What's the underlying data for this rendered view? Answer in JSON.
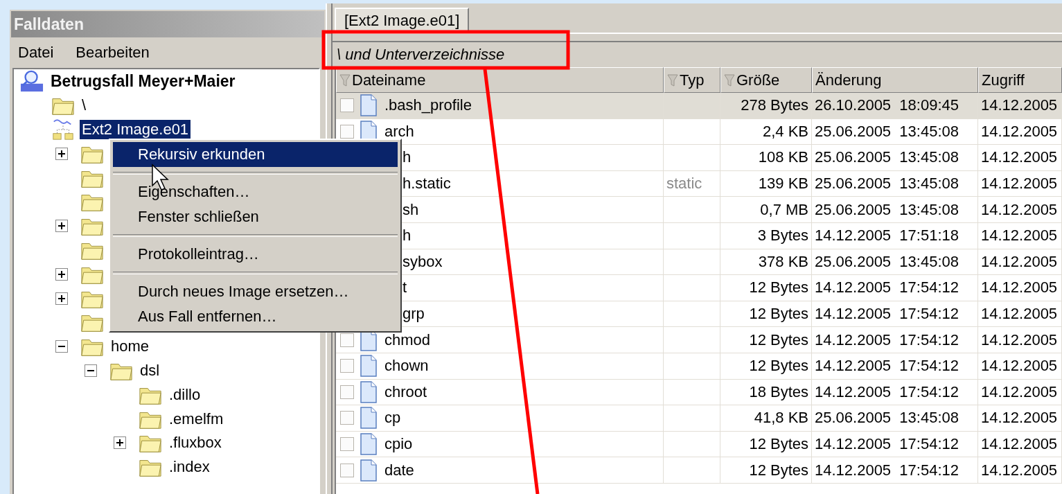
{
  "case_panel": {
    "title": "Falldaten",
    "menu": [
      "Datei",
      "Bearbeiten"
    ],
    "tree": [
      {
        "label": "Betrugsfall Meyer+Maier",
        "kind": "case",
        "selected": false,
        "children": [
          {
            "label": "\\",
            "kind": "leaf",
            "selected": false
          },
          {
            "label": "Ext2 Image.e01",
            "kind": "image",
            "selected": true,
            "children": [
              {
                "kind": "collapsed"
              },
              {
                "kind": "leaf"
              },
              {
                "kind": "leaf"
              },
              {
                "kind": "collapsed"
              },
              {
                "kind": "leaf"
              },
              {
                "kind": "collapsed"
              },
              {
                "kind": "collapsed"
              },
              {
                "kind": "leaf"
              },
              {
                "label": "home",
                "kind": "expanded",
                "selected": false,
                "children": [
                  {
                    "label": "dsl",
                    "kind": "expanded",
                    "selected": false,
                    "children": [
                      {
                        "label": ".dillo",
                        "kind": "leaf",
                        "selected": false
                      },
                      {
                        "label": ".emelfm",
                        "kind": "leaf",
                        "selected": false
                      },
                      {
                        "label": ".fluxbox",
                        "kind": "collapsed",
                        "selected": false
                      },
                      {
                        "label": ".index",
                        "kind": "leaf",
                        "selected": false
                      }
                    ]
                  }
                ]
              }
            ]
          }
        ]
      }
    ]
  },
  "context_menu": [
    {
      "kind": "item",
      "label": "Rekursiv erkunden",
      "selected": true
    },
    {
      "kind": "separator"
    },
    {
      "kind": "item",
      "label": "Eigenschaften…",
      "selected": false
    },
    {
      "kind": "item",
      "label": "Fenster schließen",
      "selected": false
    },
    {
      "kind": "separator"
    },
    {
      "kind": "item",
      "label": "Protokolleintrag…",
      "selected": false
    },
    {
      "kind": "separator"
    },
    {
      "kind": "item",
      "label": "Durch neues Image ersetzen…",
      "selected": false
    },
    {
      "kind": "item",
      "label": "Aus Fall entfernen…",
      "selected": false
    }
  ],
  "tabs": [
    {
      "label": "[Ext2 Image.e01]",
      "selected": true
    }
  ],
  "path": "\\ und Unterverzeichnisse",
  "table": {
    "columns": [
      {
        "label": "Dateiname",
        "filter": true
      },
      {
        "label": "Typ",
        "filter": true
      },
      {
        "label": "Größe",
        "filter": true
      },
      {
        "label": "Änderung",
        "filter": false
      },
      {
        "label": "Zugriff",
        "filter": false
      }
    ],
    "rows": [
      {
        "name": ".bash_profile",
        "size": "278 Bytes",
        "changed": "26.10.2005  18:09:45",
        "accessed": "14.12.2005",
        "selected": true,
        "covered": false
      },
      {
        "name": "arch",
        "size": "2,4 KB",
        "changed": "25.06.2005  13:45:08",
        "accessed": "14.12.2005",
        "selected": false,
        "covered": false
      },
      {
        "name": "h",
        "size": "108 KB",
        "changed": "25.06.2005  13:45:08",
        "accessed": "14.12.2005",
        "selected": false,
        "covered": true
      },
      {
        "name": "h.static",
        "type": "static",
        "size": "139 KB",
        "changed": "25.06.2005  13:45:08",
        "accessed": "14.12.2005",
        "selected": false,
        "covered": true
      },
      {
        "name": "sh",
        "size": "0,7 MB",
        "changed": "25.06.2005  13:45:08",
        "accessed": "14.12.2005",
        "selected": false,
        "covered": true
      },
      {
        "name": "h",
        "size": "3 Bytes",
        "changed": "14.12.2005  17:51:18",
        "accessed": "14.12.2005",
        "selected": false,
        "covered": true
      },
      {
        "name": "sybox",
        "size": "378 KB",
        "changed": "25.06.2005  13:45:08",
        "accessed": "14.12.2005",
        "selected": false,
        "covered": true
      },
      {
        "name": "t",
        "size": "12 Bytes",
        "changed": "14.12.2005  17:54:12",
        "accessed": "14.12.2005",
        "selected": false,
        "covered": true
      },
      {
        "name": "grp",
        "size": "12 Bytes",
        "changed": "14.12.2005  17:54:12",
        "accessed": "14.12.2005",
        "selected": false,
        "covered": true
      },
      {
        "name": "chmod",
        "size": "12 Bytes",
        "changed": "14.12.2005  17:54:12",
        "accessed": "14.12.2005",
        "selected": false,
        "covered": false
      },
      {
        "name": "chown",
        "size": "12 Bytes",
        "changed": "14.12.2005  17:54:12",
        "accessed": "14.12.2005",
        "selected": false,
        "covered": false
      },
      {
        "name": "chroot",
        "size": "18 Bytes",
        "changed": "14.12.2005  17:54:12",
        "accessed": "14.12.2005",
        "selected": false,
        "covered": false
      },
      {
        "name": "cp",
        "size": "41,8 KB",
        "changed": "25.06.2005  13:45:08",
        "accessed": "14.12.2005",
        "selected": false,
        "covered": false
      },
      {
        "name": "cpio",
        "size": "12 Bytes",
        "changed": "14.12.2005  17:54:12",
        "accessed": "14.12.2005",
        "selected": false,
        "covered": false
      },
      {
        "name": "date",
        "size": "12 Bytes",
        "changed": "14.12.2005  17:54:12",
        "accessed": "14.12.2005",
        "selected": false,
        "covered": false
      }
    ]
  }
}
